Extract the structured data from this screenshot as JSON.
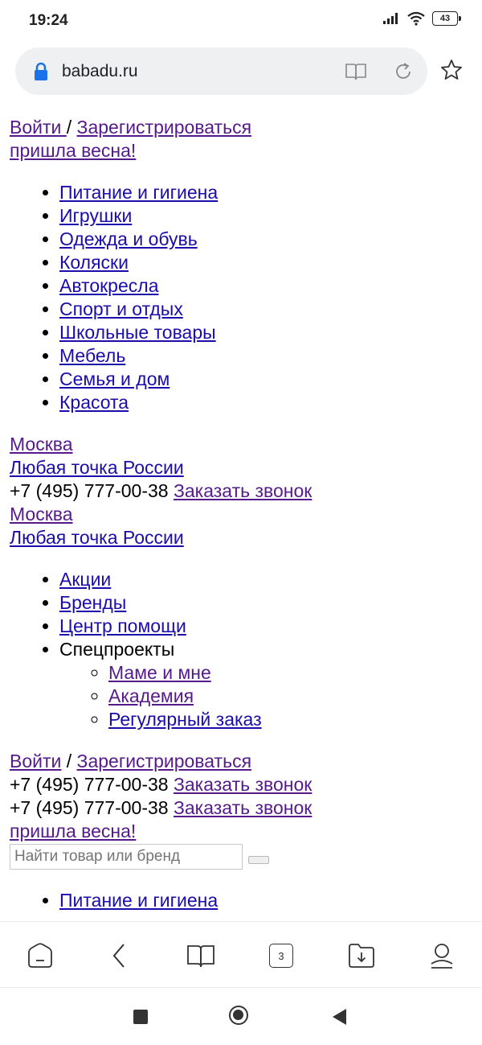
{
  "status_bar": {
    "time": "19:24",
    "battery": "43"
  },
  "browser": {
    "url": "babadu.ru",
    "tabs_count": "3"
  },
  "header": {
    "login_label": "Войти ",
    "separator": " / ",
    "register_label": "Зарегистрироваться",
    "promo_label": "пришла весна!"
  },
  "categories": [
    "Питание и гигиена",
    "Игрушки",
    "Одежда и обувь",
    "Коляски",
    "Автокресла",
    "Спорт и отдых",
    "Школьные товары",
    "Мебель",
    "Семья и дом",
    "Красота"
  ],
  "location": {
    "city": "Москва",
    "region": "Любая точка России",
    "phone": "+7 (495) 777-00-38",
    "callback_label": "Заказать звонок"
  },
  "menu": {
    "promotions": "Акции",
    "brands": "Бренды",
    "help_center": "Центр помощи",
    "special_projects": "Спецпроекты",
    "special_items": [
      "Маме и мне",
      "Академия",
      "Регулярный заказ"
    ]
  },
  "footer_header": {
    "login_label": "Войти",
    "separator": " / ",
    "register_label": "Зарегистрироваться",
    "promo_label": "пришла весна!"
  },
  "search": {
    "placeholder": "Найти товар или бренд"
  },
  "categories_repeat_first": "Питание и гигиена"
}
